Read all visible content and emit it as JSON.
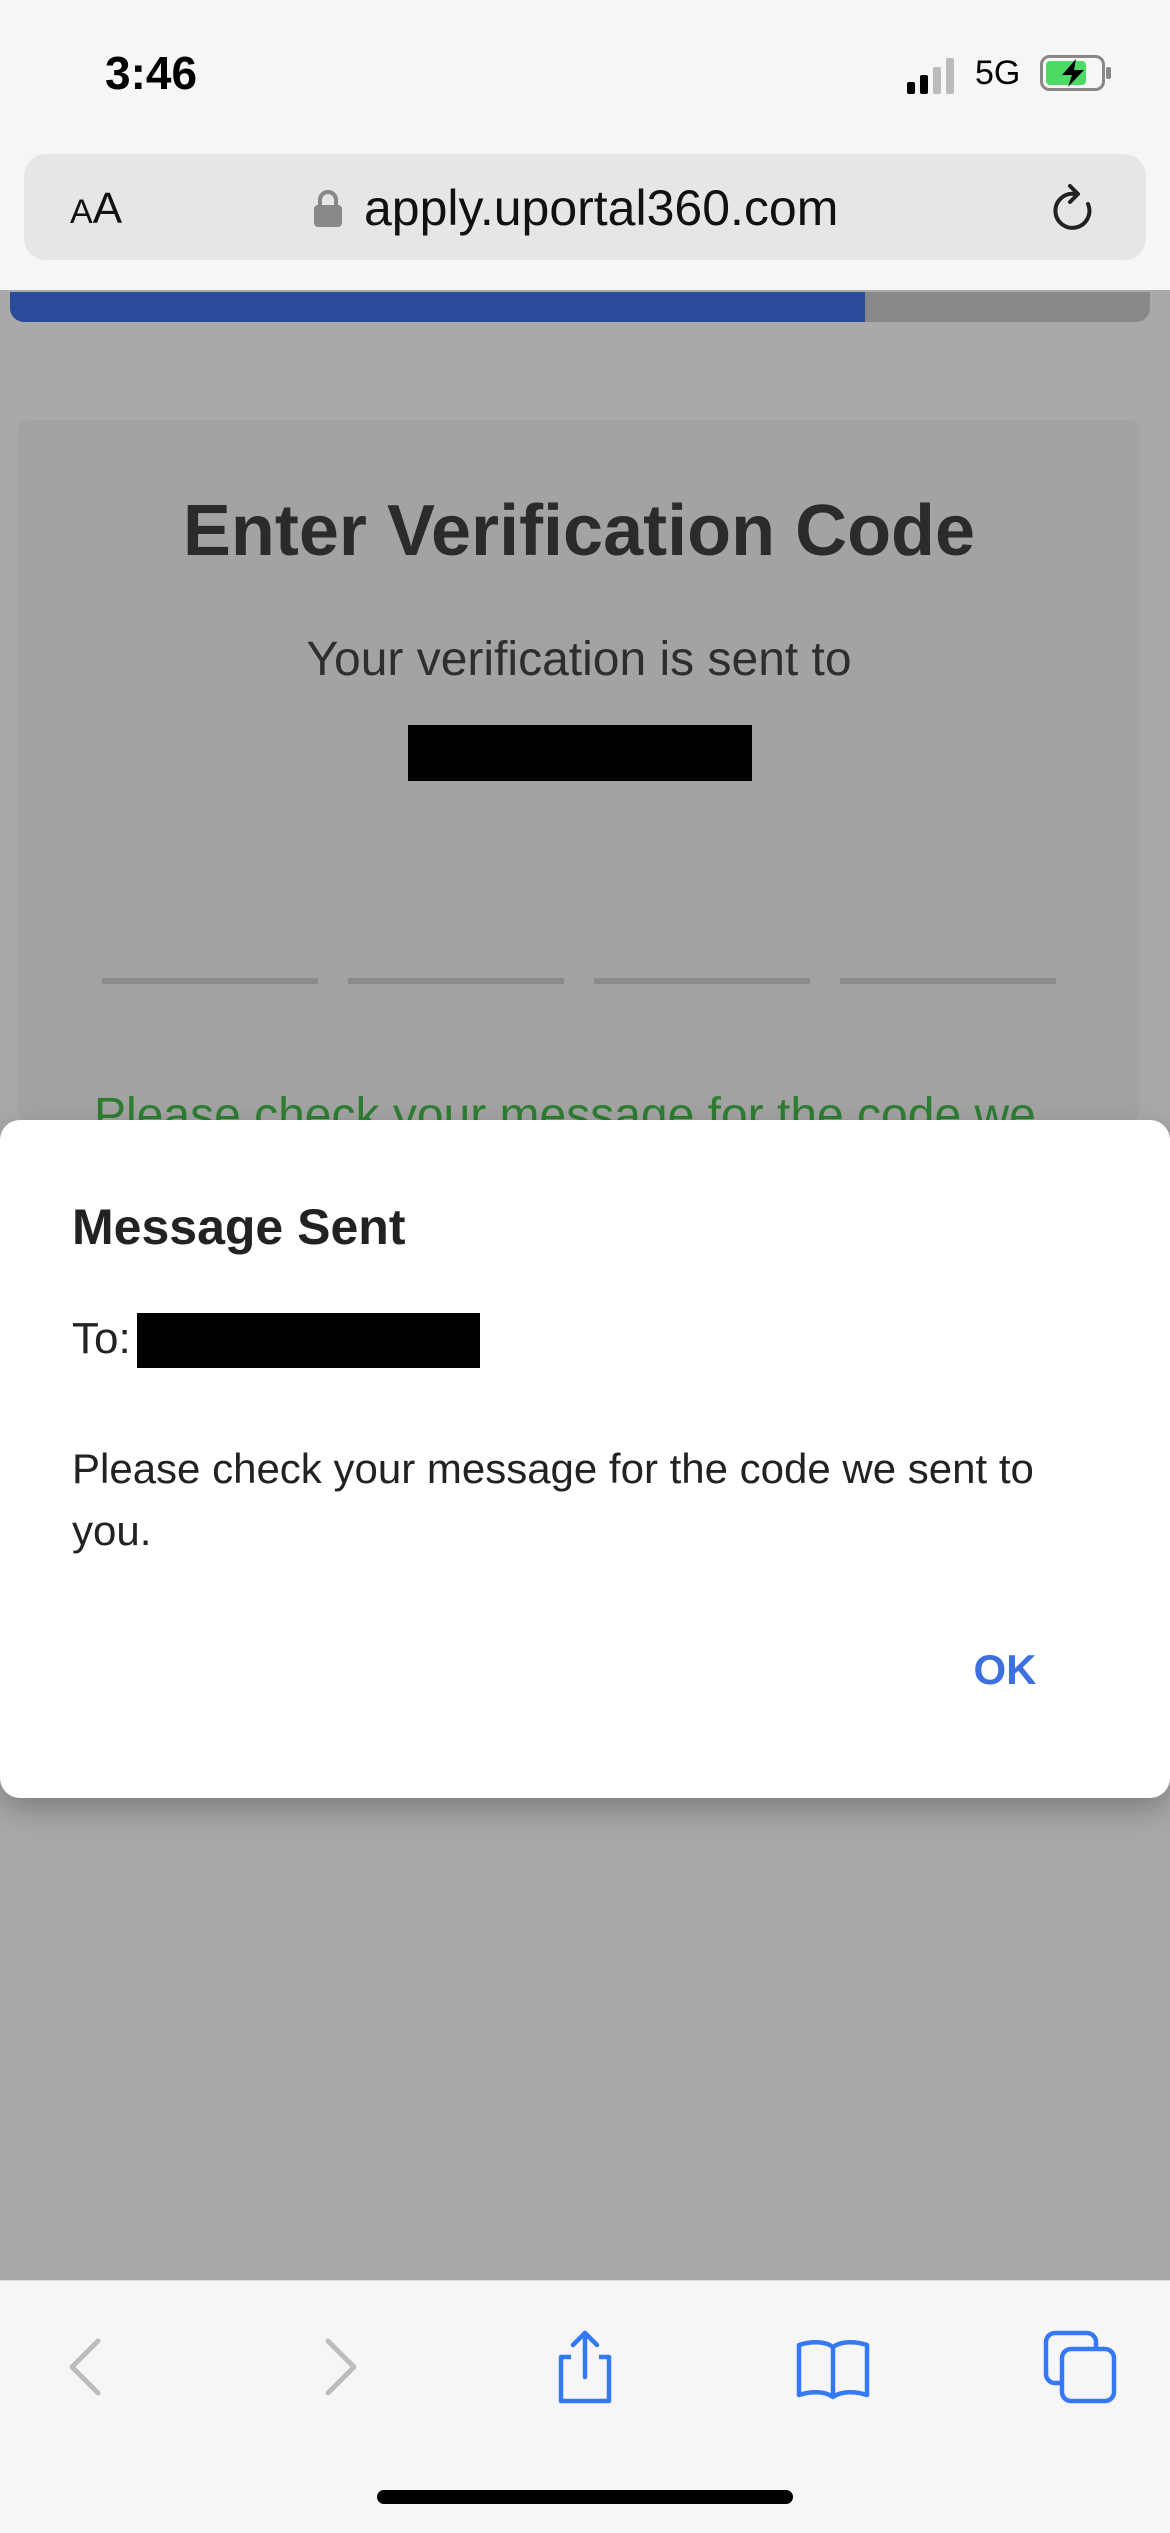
{
  "status_bar": {
    "time": "3:46",
    "network": "5G",
    "icons": [
      "signal-icon",
      "battery-charging-icon"
    ]
  },
  "browser": {
    "text_size_label_small": "A",
    "text_size_label_big": "A",
    "url": "apply.uportal360.com",
    "icons": [
      "lock-icon",
      "reload-icon"
    ]
  },
  "progress": {
    "fraction": 0.75,
    "color": "#2a4a9a"
  },
  "card": {
    "title": "Enter Verification Code",
    "subtitle": "Your verification is sent to",
    "code_fields": 4,
    "note": "Please check your message for the code we"
  },
  "dialog": {
    "title": "Message Sent",
    "to_label": "To:",
    "message": "Please check your message for the code we sent to you.",
    "ok_label": "OK",
    "accent": "#3d6fe0"
  },
  "toolbar": {
    "icons": [
      "back-icon",
      "forward-icon",
      "share-icon",
      "bookmarks-icon",
      "tabs-icon"
    ],
    "accent": "#3478f6"
  }
}
